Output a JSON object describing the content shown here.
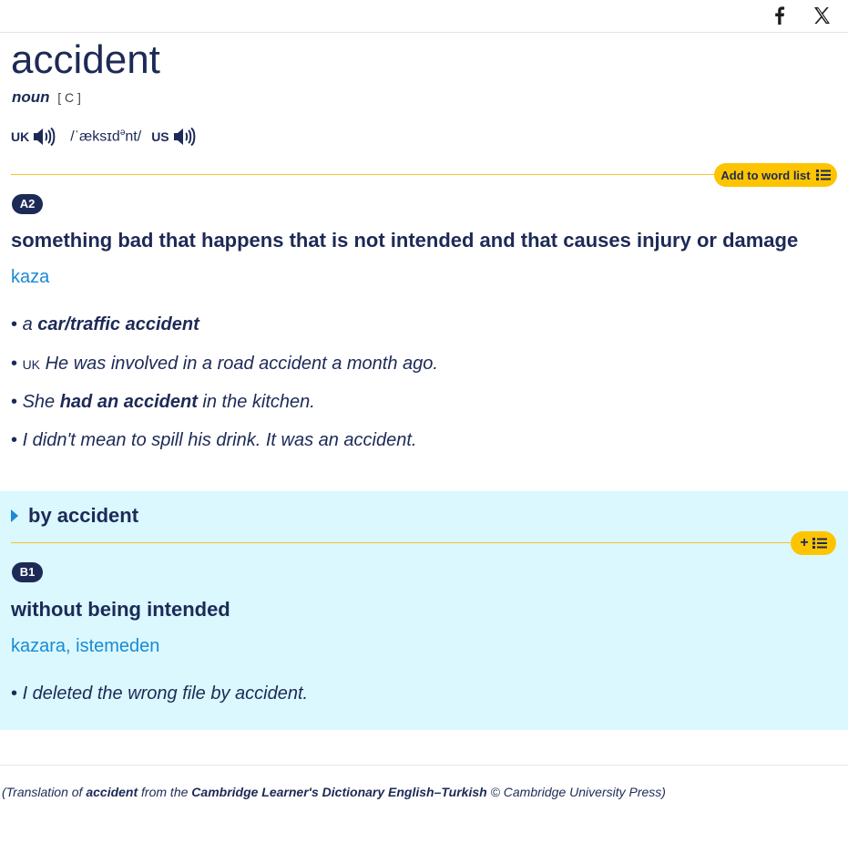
{
  "social": {
    "facebook_icon": "facebook-icon",
    "x_icon": "x-icon"
  },
  "entry": {
    "headword": "accident",
    "pos": "noun",
    "grammar": "[ C ]",
    "uk_label": "UK",
    "us_label": "US",
    "ipa": "/ˈæksɪd",
    "ipa_sup": "ə",
    "ipa_end": "nt/",
    "add_to_word_list": "Add to word list"
  },
  "sense1": {
    "level": "A2",
    "definition": "something bad that happens that is not intended and that causes injury or damage",
    "translation": "kaza",
    "examples": [
      {
        "pre": "a ",
        "bold": "car/traffic accident",
        "post": ""
      },
      {
        "label": "UK",
        "text": "He was involved in a road accident a month ago."
      },
      {
        "pre": "She ",
        "bold": "had an accident",
        "post": " in the kitchen."
      },
      {
        "text": "I didn't mean to spill his drink. It was an accident."
      }
    ]
  },
  "phrase": {
    "title": "by accident",
    "add_button": "+",
    "level": "B1",
    "definition": "without being intended",
    "translation": "kazara, istemeden",
    "example": "I deleted the wrong file by accident."
  },
  "credit": {
    "pre": "(Translation of ",
    "word": "accident",
    "mid": " from the ",
    "dict": "Cambridge Learner's Dictionary English–Turkish",
    "post": " © Cambridge University Press)"
  },
  "colors": {
    "navy": "#1d2a57",
    "accent_yellow": "#fec400",
    "link_blue": "#1a8ad4",
    "phrase_bg": "#daf8fd"
  }
}
